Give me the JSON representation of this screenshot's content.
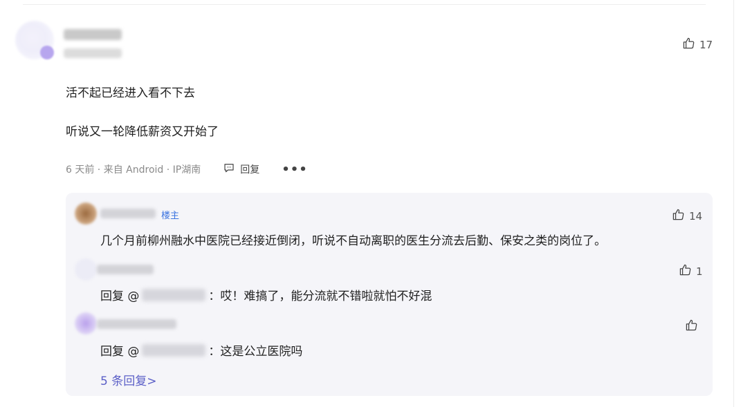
{
  "comment": {
    "likes": "17",
    "lines": [
      "活不起已经进入看不下去",
      "听说又一轮降低薪资又开始了"
    ],
    "meta_info": "6 天前 · 来自 Android · IP湖南",
    "reply_label": "回复",
    "more_label": "•••"
  },
  "replies": [
    {
      "badge": "楼主",
      "likes": "14",
      "text": "几个月前柳州融水中医院已经接近倒闭，听说不自动离职的医生分流去后勤、保安之类的岗位了。"
    },
    {
      "likes": "1",
      "prefix": "回复 @",
      "text": "：哎！难搞了，能分流就不错啦就怕不好混"
    },
    {
      "likes": "",
      "prefix": "回复 @",
      "text": "：这是公立医院吗"
    }
  ],
  "more_replies_label": "5 条回复>",
  "icons": [
    "thumbs-up-icon",
    "comment-bubble-icon",
    "more-dots-icon"
  ]
}
